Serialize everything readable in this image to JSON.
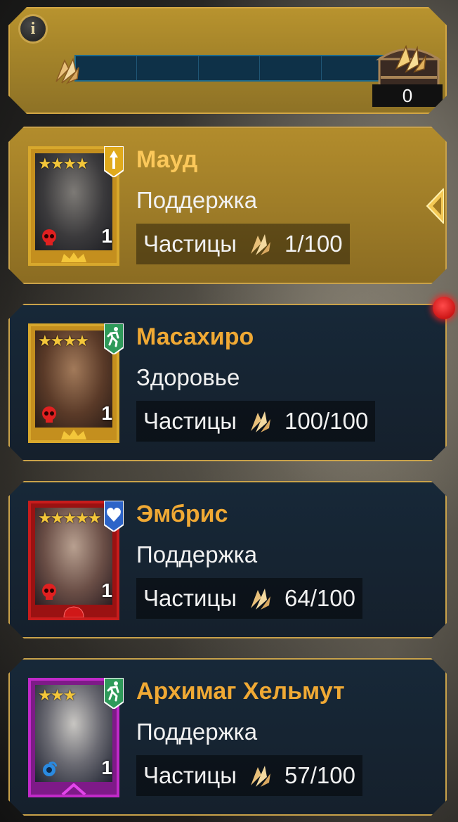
{
  "header": {
    "info_label": "i",
    "progress_fraction": 0,
    "chest_count": "0"
  },
  "labels": {
    "shards_label": "Частицы"
  },
  "heroes": [
    {
      "name": "Мауд",
      "stat": "Поддержка",
      "shards": "1/100",
      "stars": "★★★★",
      "level": "1",
      "rarity": "legendary",
      "role_icon": "attack-arrow-icon",
      "role_color": "#e0aa1c",
      "selected": true
    },
    {
      "name": "Масахиро",
      "stat": "Здоровье",
      "shards": "100/100",
      "stars": "★★★★",
      "level": "1",
      "rarity": "legendary",
      "role_icon": "running-man-icon",
      "role_color": "#2f9a5a",
      "selected": false
    },
    {
      "name": "Эмбрис",
      "stat": "Поддержка",
      "shards": "64/100",
      "stars": "★★★★★",
      "level": "1",
      "rarity": "mythic",
      "role_icon": "heart-icon",
      "role_color": "#2d64c8",
      "selected": false
    },
    {
      "name": "Архимаг Хельмут",
      "stat": "Поддержка",
      "shards": "57/100",
      "stars": "★★★",
      "level": "1",
      "rarity": "epic",
      "role_icon": "running-man-icon",
      "role_color": "#2f9a5a",
      "selected": false
    }
  ],
  "colors": {
    "accent_gold": "#f0a934",
    "panel_dark": "#172838",
    "notification_red": "#e01010"
  }
}
